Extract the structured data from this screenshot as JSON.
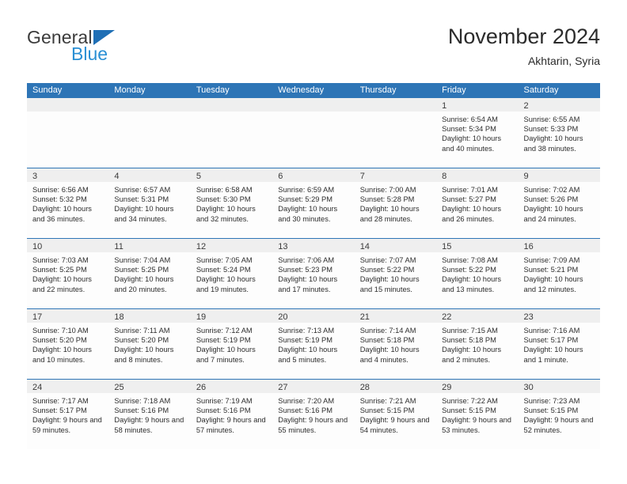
{
  "brand": {
    "name_part1": "General",
    "name_part2": "Blue",
    "logo_icon": "triangle-logo-icon"
  },
  "header": {
    "title": "November 2024",
    "subtitle": "Akhtarin, Syria"
  },
  "colors": {
    "header_blue": "#2e75b6",
    "brand_blue": "#2a8fd4",
    "day_band_gray": "#efefef",
    "text": "#2d2d2d"
  },
  "calendar": {
    "weekdays": [
      "Sunday",
      "Monday",
      "Tuesday",
      "Wednesday",
      "Thursday",
      "Friday",
      "Saturday"
    ],
    "weeks": [
      [
        {
          "day": "",
          "sunrise": "",
          "sunset": "",
          "daylight": "",
          "empty": true
        },
        {
          "day": "",
          "sunrise": "",
          "sunset": "",
          "daylight": "",
          "empty": true
        },
        {
          "day": "",
          "sunrise": "",
          "sunset": "",
          "daylight": "",
          "empty": true
        },
        {
          "day": "",
          "sunrise": "",
          "sunset": "",
          "daylight": "",
          "empty": true
        },
        {
          "day": "",
          "sunrise": "",
          "sunset": "",
          "daylight": "",
          "empty": true
        },
        {
          "day": "1",
          "sunrise": "Sunrise: 6:54 AM",
          "sunset": "Sunset: 5:34 PM",
          "daylight": "Daylight: 10 hours and 40 minutes.",
          "empty": false
        },
        {
          "day": "2",
          "sunrise": "Sunrise: 6:55 AM",
          "sunset": "Sunset: 5:33 PM",
          "daylight": "Daylight: 10 hours and 38 minutes.",
          "empty": false
        }
      ],
      [
        {
          "day": "3",
          "sunrise": "Sunrise: 6:56 AM",
          "sunset": "Sunset: 5:32 PM",
          "daylight": "Daylight: 10 hours and 36 minutes.",
          "empty": false
        },
        {
          "day": "4",
          "sunrise": "Sunrise: 6:57 AM",
          "sunset": "Sunset: 5:31 PM",
          "daylight": "Daylight: 10 hours and 34 minutes.",
          "empty": false
        },
        {
          "day": "5",
          "sunrise": "Sunrise: 6:58 AM",
          "sunset": "Sunset: 5:30 PM",
          "daylight": "Daylight: 10 hours and 32 minutes.",
          "empty": false
        },
        {
          "day": "6",
          "sunrise": "Sunrise: 6:59 AM",
          "sunset": "Sunset: 5:29 PM",
          "daylight": "Daylight: 10 hours and 30 minutes.",
          "empty": false
        },
        {
          "day": "7",
          "sunrise": "Sunrise: 7:00 AM",
          "sunset": "Sunset: 5:28 PM",
          "daylight": "Daylight: 10 hours and 28 minutes.",
          "empty": false
        },
        {
          "day": "8",
          "sunrise": "Sunrise: 7:01 AM",
          "sunset": "Sunset: 5:27 PM",
          "daylight": "Daylight: 10 hours and 26 minutes.",
          "empty": false
        },
        {
          "day": "9",
          "sunrise": "Sunrise: 7:02 AM",
          "sunset": "Sunset: 5:26 PM",
          "daylight": "Daylight: 10 hours and 24 minutes.",
          "empty": false
        }
      ],
      [
        {
          "day": "10",
          "sunrise": "Sunrise: 7:03 AM",
          "sunset": "Sunset: 5:25 PM",
          "daylight": "Daylight: 10 hours and 22 minutes.",
          "empty": false
        },
        {
          "day": "11",
          "sunrise": "Sunrise: 7:04 AM",
          "sunset": "Sunset: 5:25 PM",
          "daylight": "Daylight: 10 hours and 20 minutes.",
          "empty": false
        },
        {
          "day": "12",
          "sunrise": "Sunrise: 7:05 AM",
          "sunset": "Sunset: 5:24 PM",
          "daylight": "Daylight: 10 hours and 19 minutes.",
          "empty": false
        },
        {
          "day": "13",
          "sunrise": "Sunrise: 7:06 AM",
          "sunset": "Sunset: 5:23 PM",
          "daylight": "Daylight: 10 hours and 17 minutes.",
          "empty": false
        },
        {
          "day": "14",
          "sunrise": "Sunrise: 7:07 AM",
          "sunset": "Sunset: 5:22 PM",
          "daylight": "Daylight: 10 hours and 15 minutes.",
          "empty": false
        },
        {
          "day": "15",
          "sunrise": "Sunrise: 7:08 AM",
          "sunset": "Sunset: 5:22 PM",
          "daylight": "Daylight: 10 hours and 13 minutes.",
          "empty": false
        },
        {
          "day": "16",
          "sunrise": "Sunrise: 7:09 AM",
          "sunset": "Sunset: 5:21 PM",
          "daylight": "Daylight: 10 hours and 12 minutes.",
          "empty": false
        }
      ],
      [
        {
          "day": "17",
          "sunrise": "Sunrise: 7:10 AM",
          "sunset": "Sunset: 5:20 PM",
          "daylight": "Daylight: 10 hours and 10 minutes.",
          "empty": false
        },
        {
          "day": "18",
          "sunrise": "Sunrise: 7:11 AM",
          "sunset": "Sunset: 5:20 PM",
          "daylight": "Daylight: 10 hours and 8 minutes.",
          "empty": false
        },
        {
          "day": "19",
          "sunrise": "Sunrise: 7:12 AM",
          "sunset": "Sunset: 5:19 PM",
          "daylight": "Daylight: 10 hours and 7 minutes.",
          "empty": false
        },
        {
          "day": "20",
          "sunrise": "Sunrise: 7:13 AM",
          "sunset": "Sunset: 5:19 PM",
          "daylight": "Daylight: 10 hours and 5 minutes.",
          "empty": false
        },
        {
          "day": "21",
          "sunrise": "Sunrise: 7:14 AM",
          "sunset": "Sunset: 5:18 PM",
          "daylight": "Daylight: 10 hours and 4 minutes.",
          "empty": false
        },
        {
          "day": "22",
          "sunrise": "Sunrise: 7:15 AM",
          "sunset": "Sunset: 5:18 PM",
          "daylight": "Daylight: 10 hours and 2 minutes.",
          "empty": false
        },
        {
          "day": "23",
          "sunrise": "Sunrise: 7:16 AM",
          "sunset": "Sunset: 5:17 PM",
          "daylight": "Daylight: 10 hours and 1 minute.",
          "empty": false
        }
      ],
      [
        {
          "day": "24",
          "sunrise": "Sunrise: 7:17 AM",
          "sunset": "Sunset: 5:17 PM",
          "daylight": "Daylight: 9 hours and 59 minutes.",
          "empty": false
        },
        {
          "day": "25",
          "sunrise": "Sunrise: 7:18 AM",
          "sunset": "Sunset: 5:16 PM",
          "daylight": "Daylight: 9 hours and 58 minutes.",
          "empty": false
        },
        {
          "day": "26",
          "sunrise": "Sunrise: 7:19 AM",
          "sunset": "Sunset: 5:16 PM",
          "daylight": "Daylight: 9 hours and 57 minutes.",
          "empty": false
        },
        {
          "day": "27",
          "sunrise": "Sunrise: 7:20 AM",
          "sunset": "Sunset: 5:16 PM",
          "daylight": "Daylight: 9 hours and 55 minutes.",
          "empty": false
        },
        {
          "day": "28",
          "sunrise": "Sunrise: 7:21 AM",
          "sunset": "Sunset: 5:15 PM",
          "daylight": "Daylight: 9 hours and 54 minutes.",
          "empty": false
        },
        {
          "day": "29",
          "sunrise": "Sunrise: 7:22 AM",
          "sunset": "Sunset: 5:15 PM",
          "daylight": "Daylight: 9 hours and 53 minutes.",
          "empty": false
        },
        {
          "day": "30",
          "sunrise": "Sunrise: 7:23 AM",
          "sunset": "Sunset: 5:15 PM",
          "daylight": "Daylight: 9 hours and 52 minutes.",
          "empty": false
        }
      ]
    ]
  }
}
